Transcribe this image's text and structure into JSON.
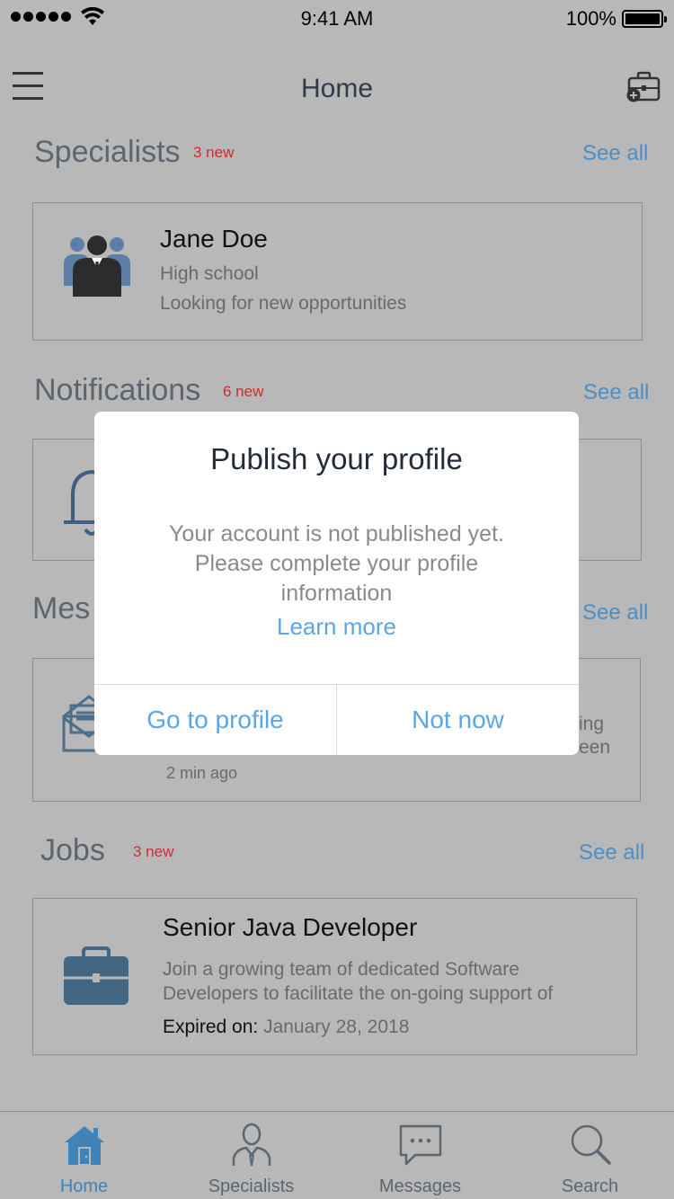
{
  "status_bar": {
    "time": "9:41 AM",
    "battery": "100%"
  },
  "header": {
    "title": "Home"
  },
  "sections": {
    "specialists": {
      "title": "Specialists",
      "badge": "3 new",
      "see_all": "See all"
    },
    "notifications": {
      "title": "Notifications",
      "badge": "6 new",
      "see_all": "See all"
    },
    "messages": {
      "title": "Mes",
      "see_all": "See all"
    },
    "jobs": {
      "title": "Jobs",
      "badge": "3 new",
      "see_all": "See all"
    }
  },
  "specialist_card": {
    "name": "Jane Doe",
    "education": "High school",
    "status": "Looking for new opportunities"
  },
  "message_card": {
    "snippet_line1": "ing",
    "snippet_line2": "een",
    "time": "2 min ago"
  },
  "job_card": {
    "title": "Senior Java Developer",
    "desc_line1": "Join a growing team of dedicated Software",
    "desc_line2": "Developers to facilitate the on-going support of",
    "expired_label": "Expired on:",
    "expired_date": "January 28, 2018"
  },
  "dialog": {
    "title": "Publish your profile",
    "body_line1": "Your account is not published yet.",
    "body_line2": "Please complete your profile",
    "body_line3": "information",
    "link": "Learn more",
    "primary": "Go to profile",
    "secondary": "Not now"
  },
  "tabs": [
    {
      "label": "Home",
      "icon": "home-icon",
      "active": true
    },
    {
      "label": "Specialists",
      "icon": "person-icon",
      "active": false
    },
    {
      "label": "Messages",
      "icon": "chat-icon",
      "active": false
    },
    {
      "label": "Search",
      "icon": "search-icon",
      "active": false
    }
  ],
  "colors": {
    "accent": "#5aa6e6",
    "badge": "#d12b2b",
    "overlay_bg": "#b8b8b8",
    "icon_blue": "#4a6e8c"
  }
}
